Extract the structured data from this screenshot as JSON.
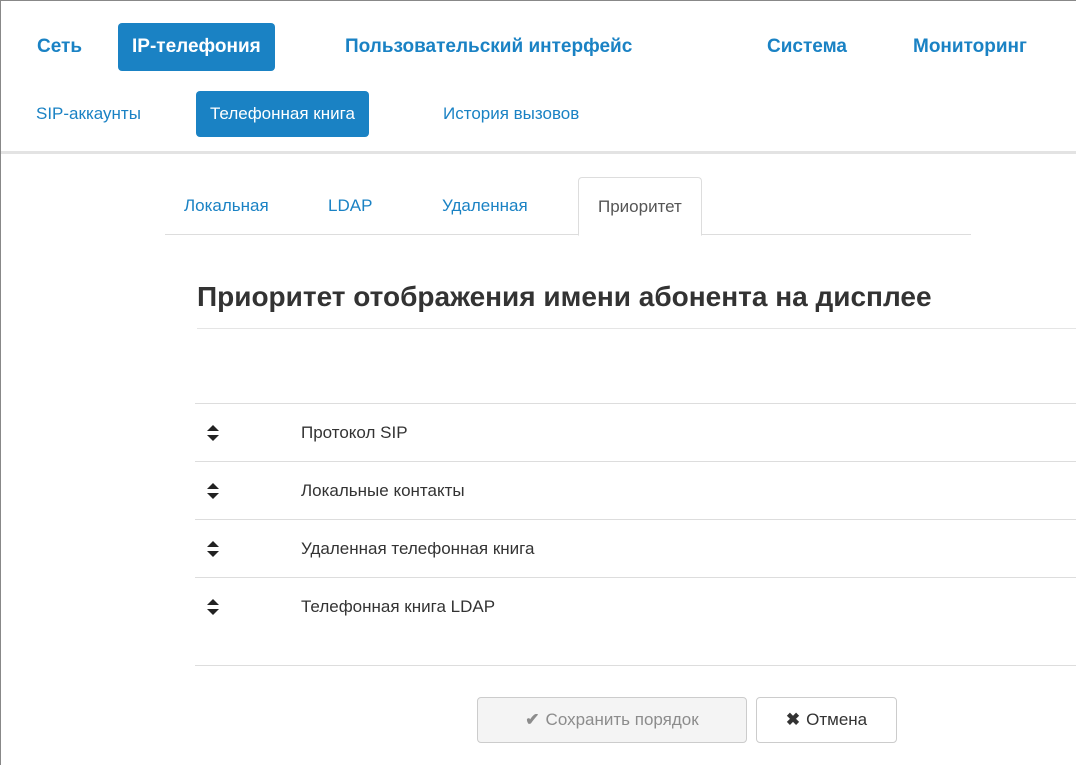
{
  "main_nav": {
    "items": [
      {
        "label": "Сеть"
      },
      {
        "label": "IP-телефония",
        "active": true
      },
      {
        "label": "Пользовательский интерфейс"
      },
      {
        "label": "Система"
      },
      {
        "label": "Мониторинг"
      }
    ]
  },
  "sub_nav": {
    "items": [
      {
        "label": "SIP-аккаунты"
      },
      {
        "label": "Телефонная книга",
        "active": true
      },
      {
        "label": "История вызовов"
      }
    ]
  },
  "tabs": [
    {
      "label": "Локальная"
    },
    {
      "label": "LDAP"
    },
    {
      "label": "Удаленная"
    },
    {
      "label": "Приоритет",
      "active": true
    }
  ],
  "section": {
    "title": "Приоритет отображения имени абонента на дисплее"
  },
  "priority_list": [
    {
      "label": "Протокол SIP",
      "icon": "sort-handle-icon"
    },
    {
      "label": "Локальные контакты",
      "icon": "sort-handle-icon"
    },
    {
      "label": "Удаленная телефонная книга",
      "icon": "sort-handle-icon"
    },
    {
      "label": "Телефонная книга LDAP",
      "icon": "sort-handle-icon"
    }
  ],
  "buttons": {
    "save": {
      "label": "Сохранить порядок",
      "icon": "check-icon",
      "disabled": true
    },
    "cancel": {
      "label": "Отмена",
      "icon": "close-icon"
    }
  },
  "colors": {
    "accent": "#1a82c4",
    "text": "#333333",
    "border": "#dddddd"
  }
}
